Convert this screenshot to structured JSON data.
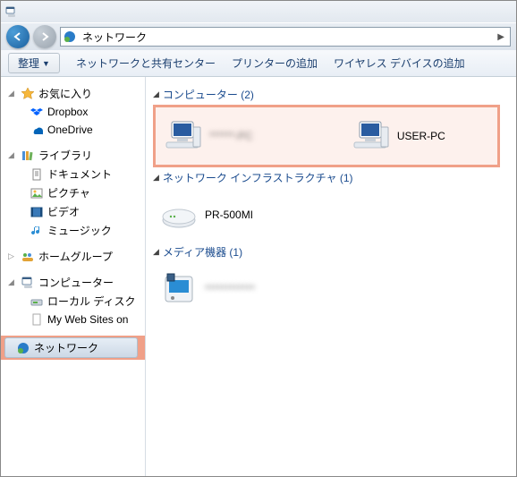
{
  "address": {
    "location": "ネットワーク",
    "separator": "▶"
  },
  "toolbar": {
    "organize": "整理",
    "links": [
      "ネットワークと共有センター",
      "プリンターの追加",
      "ワイヤレス デバイスの追加"
    ]
  },
  "sidebar": {
    "favorites": {
      "label": "お気に入り",
      "items": [
        "Dropbox",
        "OneDrive"
      ]
    },
    "libraries": {
      "label": "ライブラリ",
      "items": [
        "ドキュメント",
        "ピクチャ",
        "ビデオ",
        "ミュージック"
      ]
    },
    "homegroup": {
      "label": "ホームグループ"
    },
    "computer": {
      "label": "コンピューター",
      "items": [
        "ローカル ディスク",
        "My Web Sites on"
      ]
    },
    "network": {
      "label": "ネットワーク"
    }
  },
  "content": {
    "computers": {
      "label": "コンピューター (2)",
      "items": [
        {
          "name": "******-PC",
          "blurred": true
        },
        {
          "name": "USER-PC",
          "blurred": false
        }
      ]
    },
    "infra": {
      "label": "ネットワーク インフラストラクチャ (1)",
      "items": [
        {
          "name": "PR-500MI"
        }
      ]
    },
    "media": {
      "label": "メディア機器 (1)",
      "items": [
        {
          "name": "************",
          "blurred": true
        }
      ]
    }
  }
}
